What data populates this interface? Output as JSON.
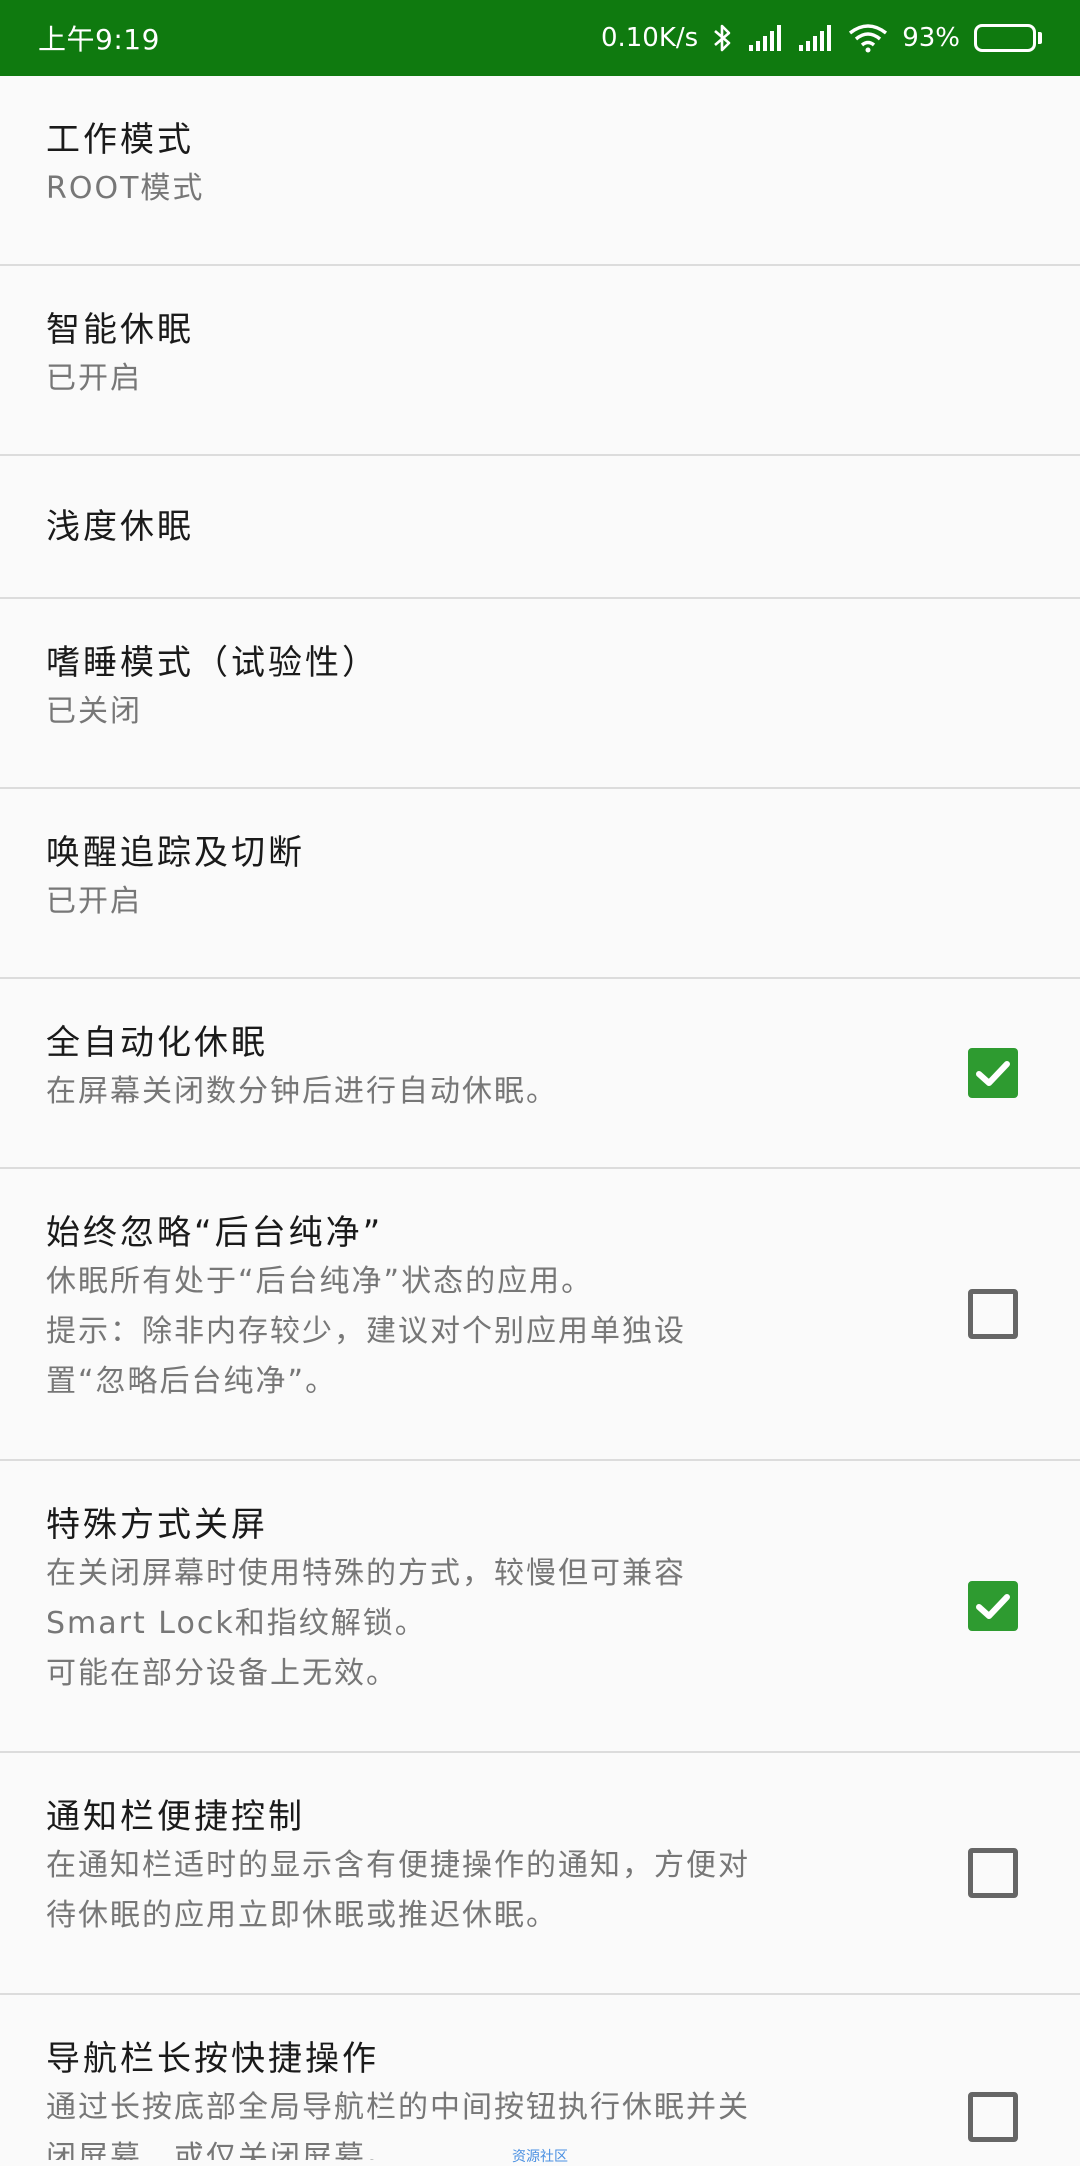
{
  "status_bar": {
    "time": "上午9:19",
    "net_speed": "0.10K/s",
    "battery_percent": "93%",
    "battery_level": 0.93,
    "icons": [
      "bluetooth-icon",
      "signal-icon",
      "signal-icon",
      "wifi-icon",
      "battery-icon"
    ],
    "background_color": "#0f7a0f",
    "battery_color": "#f0b428"
  },
  "settings": [
    {
      "title": "工作模式",
      "lines": [
        "ROOT模式"
      ]
    },
    {
      "title": "智能休眠",
      "lines": [
        "已开启"
      ]
    },
    {
      "title": "浅度休眠",
      "lines": []
    },
    {
      "title": "嗜睡模式（试验性）",
      "lines": [
        "已关闭"
      ]
    },
    {
      "title": "唤醒追踪及切断",
      "lines": [
        "已开启"
      ]
    },
    {
      "title": "全自动化休眠",
      "lines": [
        "在屏幕关闭数分钟后进行自动休眠。"
      ],
      "checked": true
    },
    {
      "title": "始终忽略“后台纯净”",
      "lines": [
        "休眠所有处于“后台纯净”状态的应用。",
        "提示：除非内存较少，建议对个别应用单独设",
        "置“忽略后台纯净”。"
      ],
      "checked": false
    },
    {
      "title": "特殊方式关屏",
      "lines": [
        "在关闭屏幕时使用特殊的方式，较慢但可兼容",
        "Smart Lock和指纹解锁。",
        "可能在部分设备上无效。"
      ],
      "checked": true
    },
    {
      "title": "通知栏便捷控制",
      "lines": [
        "在通知栏适时的显示含有便捷操作的通知，方便对",
        "待休眠的应用立即休眠或推迟休眠。"
      ],
      "checked": false
    },
    {
      "title": "导航栏长按快捷操作",
      "lines": [
        "通过长按底部全局导航栏的中间按钮执行休眠并关",
        "闭屏幕，或仅关闭屏幕。"
      ],
      "checked": false
    }
  ],
  "watermark": "资源社区",
  "checkbox_color": "#2e9b30"
}
